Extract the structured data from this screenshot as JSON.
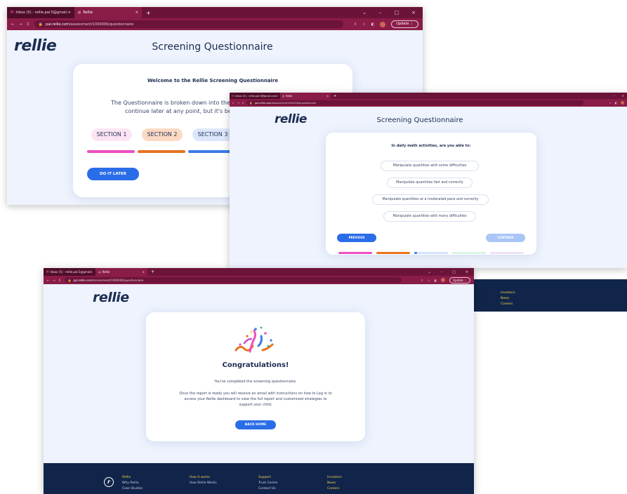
{
  "browser": {
    "tab_inbox_label": "Inbox (5) - rellie.pal.5@gmail.com",
    "tab_rellie_label": "Rellie",
    "new_tab_symbol": "+",
    "close_symbol": "×",
    "url_host": "pal.rellie.com",
    "url_path": "/assessment/1000006/questionnaire",
    "update_label": "Update",
    "minimize_symbol": "–",
    "maximize_symbol": "□",
    "window_close_symbol": "×"
  },
  "brand": {
    "logo_text": "rellie"
  },
  "shot1": {
    "page_title": "Screening Questionnaire",
    "welcome_heading": "Welcome to the Rellie Screening Questionnaire",
    "intro_line1": "The Questionnaire is broken down into the sub",
    "intro_line2": "continue later at any point, but it's best if",
    "sections": [
      "SECTION 1",
      "SECTION 2",
      "SECTION 3"
    ],
    "do_it_later_label": "DO IT LATER"
  },
  "shot2": {
    "page_title": "Screening Questionnaire",
    "question": "In daily math activities, are you able to:",
    "options": [
      "Manipulate quantities with some difficulties",
      "Manipulate quantities fast and correctly",
      "Manipulate quantities at a moderated pace and correctly",
      "Manipulate quantities with many difficulties"
    ],
    "previous_label": "PREVIOUS",
    "continue_label": "CONTINUE",
    "footer_links": [
      "Investors",
      "News",
      "Careers"
    ]
  },
  "shot3": {
    "congrats_heading": "Congratulations!",
    "completed_text": "You've completed the screening questionnaire.",
    "report_text_line1": "Once the report is ready you will receive an email with instructions on how to Log in to",
    "report_text_line2": "access your Rellie dashboard to view the full report and customized strategies to",
    "report_text_line3": "support your child.",
    "back_home_label": "BACK HOME",
    "footer_cols": [
      {
        "head": "Rellie",
        "items": [
          "Why Rellie",
          "Case Studies"
        ]
      },
      {
        "head": "How it works",
        "items": [
          "How Rellie Works"
        ]
      },
      {
        "head": "Support",
        "items": [
          "Trust Centre",
          "Contact Us"
        ]
      },
      {
        "head": "Investors",
        "items": [
          "News",
          "Careers"
        ]
      }
    ]
  },
  "colors": {
    "browser_maroon": "#6c1339",
    "page_bg": "#eef3fd",
    "navy": "#1c2d52",
    "primary_blue": "#2a6de8",
    "section1_pink": "#ec4fc0",
    "section2_orange": "#e8731f",
    "section3_blue": "#3d7ae8",
    "footer_navy": "#11254a",
    "footer_yellow": "#f4d34a"
  }
}
